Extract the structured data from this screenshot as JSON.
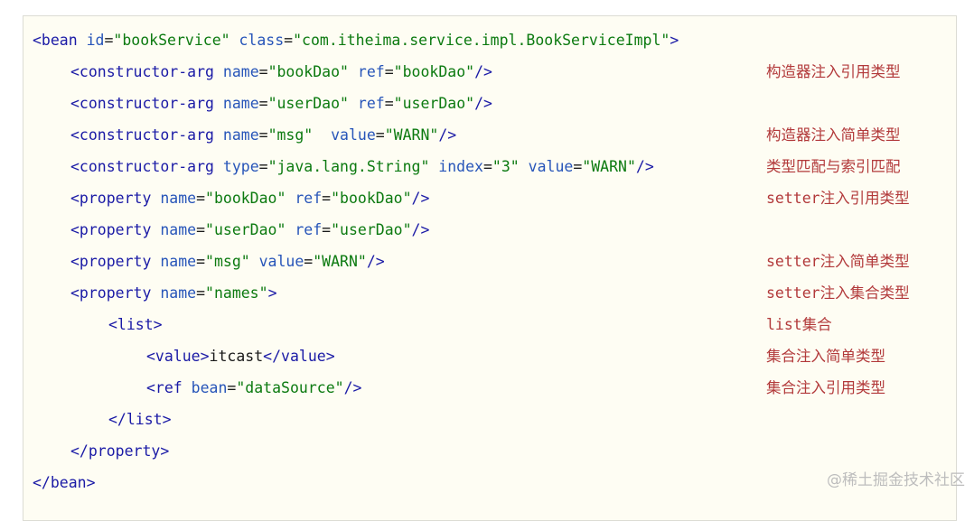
{
  "lines": [
    {
      "tag_open": "<bean",
      "a1": " id",
      "eq1": "=",
      "v1": "\"bookService\"",
      "a2": " class",
      "eq2": "=",
      "v2": "\"com.itheima.service.impl.BookServiceImpl\"",
      "tag_close": ">"
    },
    {
      "tag_open": "<constructor-arg",
      "a1": " name",
      "eq1": "=",
      "v1": "\"bookDao\"",
      "a2": " ref",
      "eq2": "=",
      "v2": "\"bookDao\"",
      "tag_close": "/>"
    },
    {
      "tag_open": "<constructor-arg",
      "a1": " name",
      "eq1": "=",
      "v1": "\"userDao\"",
      "a2": " ref",
      "eq2": "=",
      "v2": "\"userDao\"",
      "tag_close": "/>"
    },
    {
      "tag_open": "<constructor-arg",
      "a1": " name",
      "eq1": "=",
      "v1": "\"msg\"",
      "a2": "  value",
      "eq2": "=",
      "v2": "\"WARN\"",
      "tag_close": "/>"
    },
    {
      "tag_open": "<constructor-arg",
      "a1": " type",
      "eq1": "=",
      "v1": "\"java.lang.String\"",
      "a2": " index",
      "eq2": "=",
      "v2": "\"3\"",
      "a3": " value",
      "eq3": "=",
      "v3": "\"WARN\"",
      "tag_close": "/>"
    },
    {
      "tag_open": "<property",
      "a1": " name",
      "eq1": "=",
      "v1": "\"bookDao\"",
      "a2": " ref",
      "eq2": "=",
      "v2": "\"bookDao\"",
      "tag_close": "/>"
    },
    {
      "tag_open": "<property",
      "a1": " name",
      "eq1": "=",
      "v1": "\"userDao\"",
      "a2": " ref",
      "eq2": "=",
      "v2": "\"userDao\"",
      "tag_close": "/>"
    },
    {
      "tag_open": "<property",
      "a1": " name",
      "eq1": "=",
      "v1": "\"msg\"",
      "a2": " value",
      "eq2": "=",
      "v2": "\"WARN\"",
      "tag_close": "/>"
    },
    {
      "tag_open": "<property",
      "a1": " name",
      "eq1": "=",
      "v1": "\"names\"",
      "tag_close": ">"
    },
    {
      "tag_open": "<list",
      "tag_close": ">"
    },
    {
      "tag_open": "<value",
      "tag_close": ">",
      "text": "itcast",
      "end_tag": "</value",
      "end_close": ">"
    },
    {
      "tag_open": "<ref",
      "a1": " bean",
      "eq1": "=",
      "v1": "\"dataSource\"",
      "tag_close": "/>"
    },
    {
      "tag_open": "</list",
      "tag_close": ">"
    },
    {
      "tag_open": "</property",
      "tag_close": ">"
    },
    {
      "tag_open": "</bean",
      "tag_close": ">"
    }
  ],
  "notes": {
    "n1": "构造器注入引用类型",
    "n3": "构造器注入简单类型",
    "n4": "类型匹配与索引匹配",
    "n5": "setter注入引用类型",
    "n7": "setter注入简单类型",
    "n8": "setter注入集合类型",
    "n9": "list集合",
    "n10": "集合注入简单类型",
    "n11": "集合注入引用类型"
  },
  "watermark": "@稀土掘金技术社区",
  "colors": {
    "background": "#fefdf3",
    "tag": "#1a1aa6",
    "attribute": "#2755b9",
    "value": "#0c7a10",
    "note": "#b2393a"
  }
}
